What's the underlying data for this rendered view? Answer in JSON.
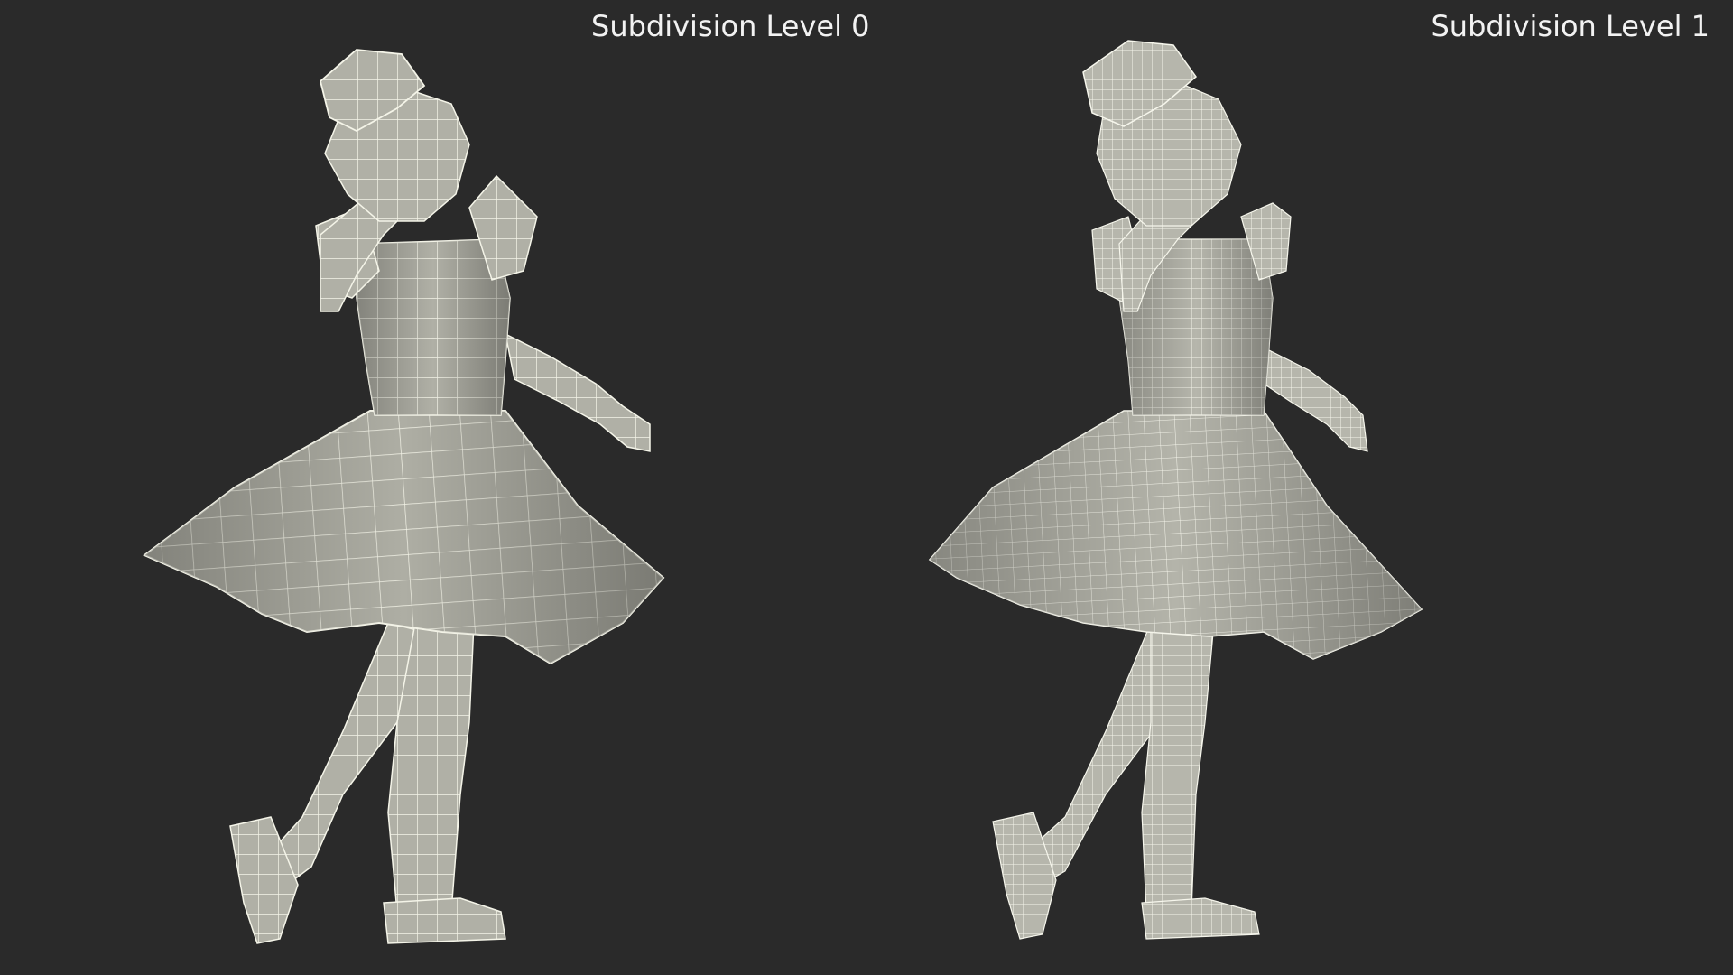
{
  "viewport": {
    "background": "#2a2a2a",
    "mesh_fill": "#b3b3a9",
    "mesh_wire": "#f4f4e9",
    "mesh_shadow": "#6f6f66"
  },
  "panels": [
    {
      "label": "Subdivision Level 0",
      "density": "coarse"
    },
    {
      "label": "Subdivision Level 1",
      "density": "fine"
    }
  ]
}
